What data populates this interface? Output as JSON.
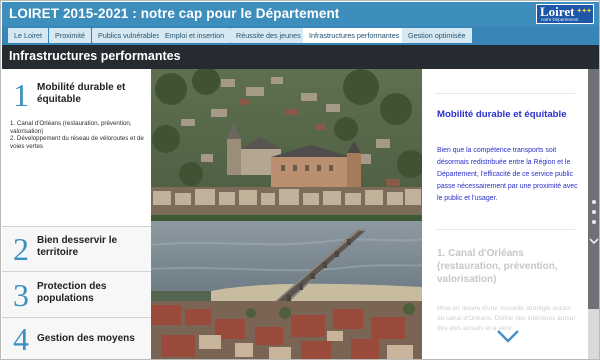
{
  "header": {
    "title": "LOIRET 2015-2021 : notre cap pour le Département",
    "logo_main": "Loiret",
    "logo_sub": "notre Département"
  },
  "tabs": [
    {
      "label": "Le Loiret"
    },
    {
      "label": "Proximité"
    },
    {
      "label": "Publics vulnérables"
    },
    {
      "label": "Emploi et insertion"
    },
    {
      "label": "Réussite des jeunes"
    },
    {
      "label": "Infrastructures performantes",
      "active": true
    },
    {
      "label": "Gestion optimisée"
    }
  ],
  "section": {
    "title": "Infrastructures performantes"
  },
  "menu": [
    {
      "number": "1",
      "label": "Mobilité durable et équitable",
      "sub": "1. Canal d'Orléans (restauration, prévention, valorisation)\n2. Développement du réseau de véloroutes et de voies vertes",
      "active": true
    },
    {
      "number": "2",
      "label": "Bien desservir le territoire"
    },
    {
      "number": "3",
      "label": "Protection des populations"
    },
    {
      "number": "4",
      "label": "Gestion des moyens"
    }
  ],
  "panel": {
    "title": "Mobilité durable et équitable",
    "text": "Bien que la compétence transports soit désormais redistribuée entre la Région et le Département, l'efficacité de ce service public passe nécessairement par une proximité avec le public et l'usager.",
    "subheading": "1. Canal d'Orléans (restauration, prévention, valorisation)",
    "faint": "Mise en œuvre d'une nouvelle stratégie autour du canal d'Orléans. Définir des intentions autour des élus actuels et à venir"
  },
  "colors": {
    "header": "#3d8dbd",
    "tabbar": "#3786b7",
    "section": "#262b31",
    "accent_number": "#3b8fc1",
    "panel_text": "#2a2fc9"
  }
}
